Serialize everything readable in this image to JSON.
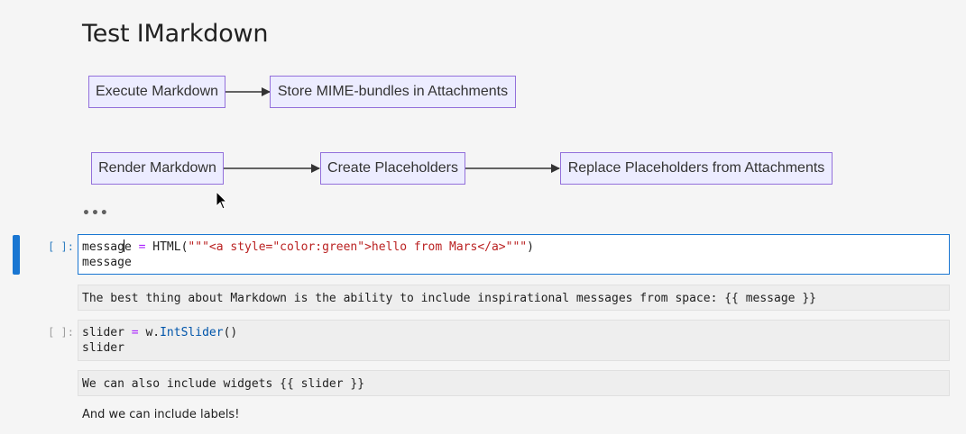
{
  "heading": "Test IMarkdown",
  "diagram": {
    "nodes": {
      "execute": "Execute Markdown",
      "store": "Store MIME-bundles in Attachments",
      "render": "Render Markdown",
      "create": "Create Placeholders",
      "replace": "Replace Placeholders from Attachments"
    },
    "colors": {
      "fill": "#ececff",
      "stroke": "#9370db",
      "edge": "#333333"
    }
  },
  "collapsed_indicator": "•••",
  "cells": {
    "code1": {
      "prompt": "[ ]:",
      "line1_a": "messag",
      "line1_b": "e ",
      "line1_eq": "=",
      "line1_c": " HTML(",
      "line1_str": "\"\"\"<a style=\"color:green\">hello from Mars</a>\"\"\"",
      "line1_d": ")",
      "line2": "message"
    },
    "md1": "The best thing about Markdown is the ability to include inspirational messages from space: {{ message }}",
    "code2": {
      "prompt": "[ ]:",
      "line1_a": "slider ",
      "line1_eq": "=",
      "line1_b": " w.",
      "line1_fn": "IntSlider",
      "line1_c": "()",
      "line2": "slider"
    },
    "md2": "We can also include widgets {{ slider }}"
  },
  "rendered_text": "And we can include labels!",
  "colors": {
    "active_bar": "#1976d2",
    "prompt_active": "#307fc1"
  }
}
